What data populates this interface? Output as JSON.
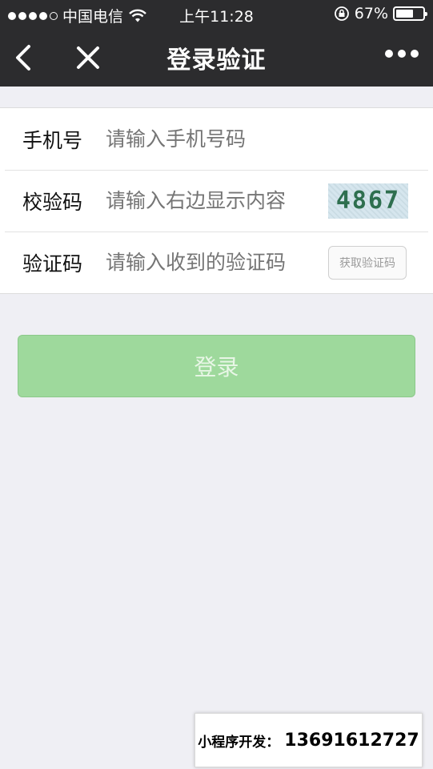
{
  "status_bar": {
    "carrier": "中国电信",
    "time": "上午11:28",
    "battery_percent": "67%",
    "battery_level": 0.67,
    "signal_bars_filled": 4,
    "signal_bars_total": 5
  },
  "nav": {
    "title": "登录验证",
    "back_icon": "chevron-left-icon",
    "close_icon": "close-icon",
    "more_icon": "more-dots-icon"
  },
  "form": {
    "phone": {
      "label": "手机号",
      "placeholder": "请输入手机号码"
    },
    "captcha": {
      "label": "校验码",
      "placeholder": "请输入右边显示内容",
      "image_text": "4867"
    },
    "sms_code": {
      "label": "验证码",
      "placeholder": "请输入收到的验证码",
      "button_label": "获取验证码"
    }
  },
  "login_button": {
    "label": "登录"
  },
  "promo": {
    "label": "小程序开发：",
    "phone": "13691612727"
  },
  "colors": {
    "nav_bg": "#2c2c2e",
    "page_bg": "#efeff4",
    "login_button_bg": "#9ed99c"
  }
}
